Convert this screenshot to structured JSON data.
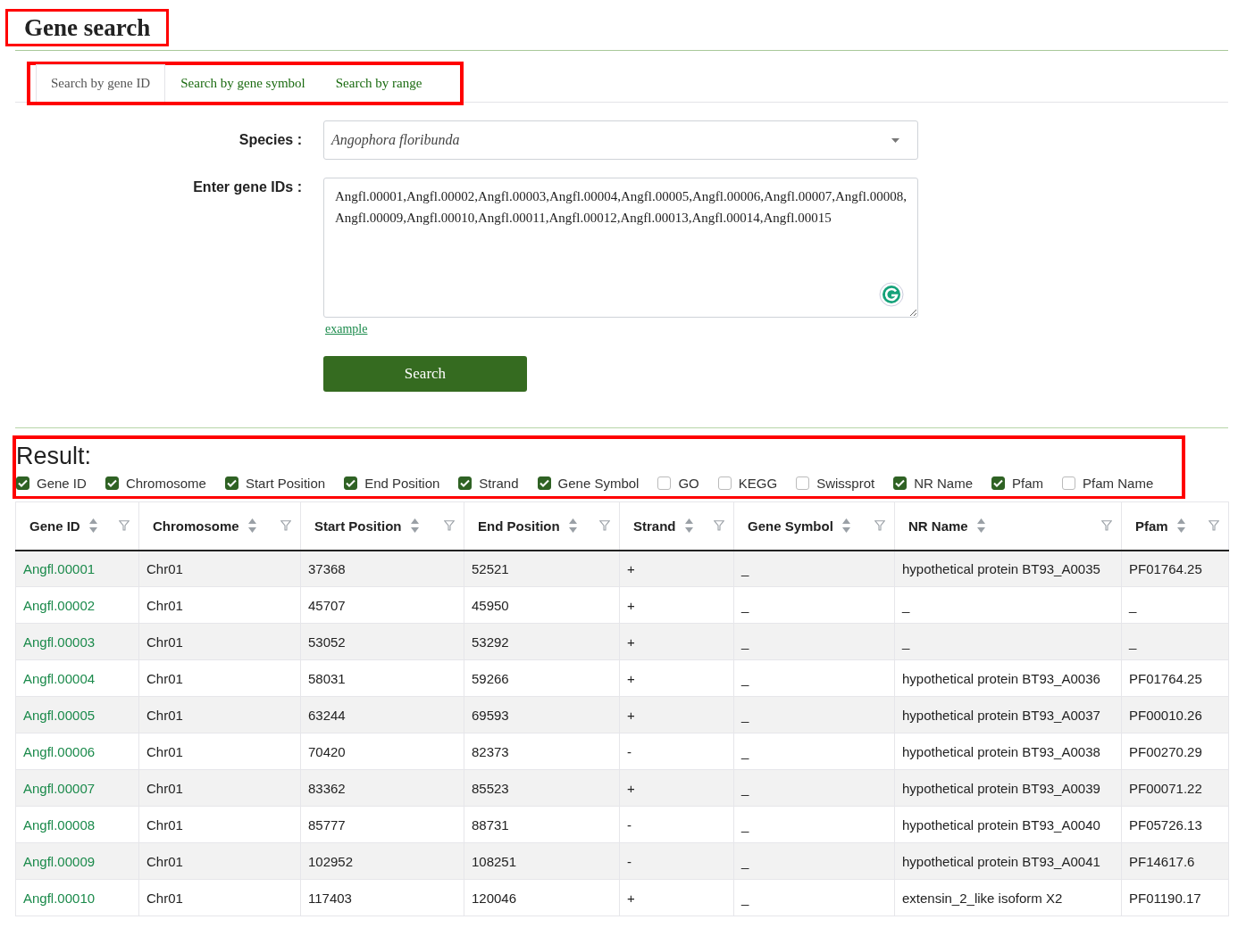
{
  "title": "Gene search",
  "tabs": [
    {
      "label": "Search by gene ID",
      "selected": true
    },
    {
      "label": "Search by gene symbol",
      "selected": false
    },
    {
      "label": "Search by range",
      "selected": false
    }
  ],
  "form": {
    "species_label": "Species :",
    "species_value": "Angophora floribunda",
    "ids_label": "Enter gene IDs :",
    "ids_value": "Angfl.00001,Angfl.00002,Angfl.00003,Angfl.00004,Angfl.00005,Angfl.00006,Angfl.00007,Angfl.00008,Angfl.00009,Angfl.00010,Angfl.00011,Angfl.00012,Angfl.00013,Angfl.00014,Angfl.00015",
    "example_link": "example",
    "search_button": "Search"
  },
  "result": {
    "heading": "Result:",
    "column_toggles": [
      {
        "label": "Gene ID",
        "checked": true
      },
      {
        "label": "Chromosome",
        "checked": true
      },
      {
        "label": "Start Position",
        "checked": true
      },
      {
        "label": "End Position",
        "checked": true
      },
      {
        "label": "Strand",
        "checked": true
      },
      {
        "label": "Gene Symbol",
        "checked": true
      },
      {
        "label": "GO",
        "checked": false
      },
      {
        "label": "KEGG",
        "checked": false
      },
      {
        "label": "Swissprot",
        "checked": false
      },
      {
        "label": "NR Name",
        "checked": true
      },
      {
        "label": "Pfam",
        "checked": true
      },
      {
        "label": "Pfam Name",
        "checked": false
      }
    ],
    "table": {
      "columns": [
        "Gene ID",
        "Chromosome",
        "Start Position",
        "End Position",
        "Strand",
        "Gene Symbol",
        "NR Name",
        "Pfam"
      ],
      "rows": [
        [
          "Angfl.00001",
          "Chr01",
          "37368",
          "52521",
          "+",
          "_",
          "hypothetical protein BT93_A0035",
          "PF01764.25"
        ],
        [
          "Angfl.00002",
          "Chr01",
          "45707",
          "45950",
          "+",
          "_",
          "_",
          "_"
        ],
        [
          "Angfl.00003",
          "Chr01",
          "53052",
          "53292",
          "+",
          "_",
          "_",
          "_"
        ],
        [
          "Angfl.00004",
          "Chr01",
          "58031",
          "59266",
          "+",
          "_",
          "hypothetical protein BT93_A0036",
          "PF01764.25"
        ],
        [
          "Angfl.00005",
          "Chr01",
          "63244",
          "69593",
          "+",
          "_",
          "hypothetical protein BT93_A0037",
          "PF00010.26"
        ],
        [
          "Angfl.00006",
          "Chr01",
          "70420",
          "82373",
          "-",
          "_",
          "hypothetical protein BT93_A0038",
          "PF00270.29"
        ],
        [
          "Angfl.00007",
          "Chr01",
          "83362",
          "85523",
          "+",
          "_",
          "hypothetical protein BT93_A0039",
          "PF00071.22"
        ],
        [
          "Angfl.00008",
          "Chr01",
          "85777",
          "88731",
          "-",
          "_",
          "hypothetical protein BT93_A0040",
          "PF05726.13"
        ],
        [
          "Angfl.00009",
          "Chr01",
          "102952",
          "108251",
          "-",
          "_",
          "hypothetical protein BT93_A0041",
          "PF14617.6"
        ],
        [
          "Angfl.00010",
          "Chr01",
          "117403",
          "120046",
          "+",
          "_",
          "extensin_2_like isoform X2",
          "PF01190.17"
        ]
      ]
    }
  }
}
